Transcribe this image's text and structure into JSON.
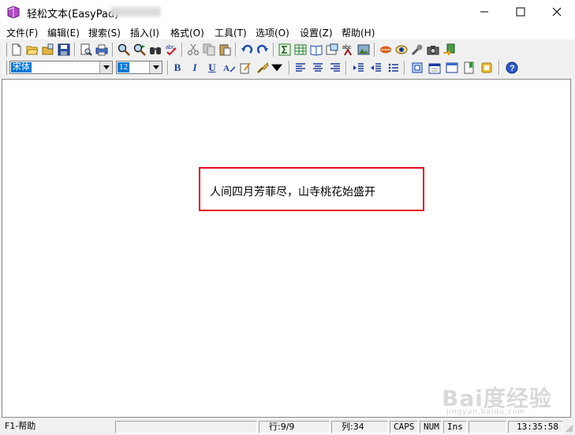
{
  "window": {
    "title": "轻松文本(EasyPad)"
  },
  "menu": [
    "文件(F)",
    "编辑(E)",
    "搜索(S)",
    "插入(I)",
    "格式(O)",
    "工具(T)",
    "选项(O)",
    "设置(Z)",
    "帮助(H)"
  ],
  "format_bar": {
    "font_name": "宋体",
    "font_size": "12",
    "bold_label": "B",
    "italic_label": "I",
    "underline_label": "U"
  },
  "document": {
    "text": "人间四月芳菲尽，山寺桃花始盛开"
  },
  "status": {
    "help": "F1-帮助",
    "row": "行:9/9",
    "col": "列:34",
    "caps": "CAPS",
    "num": "NUM",
    "ins": "Ins",
    "time": "13:35:58"
  },
  "watermark": {
    "text": "Bai度经验",
    "sub": "jingyan.baidu.com"
  },
  "icons": {
    "toolbar1": [
      "new-file-icon",
      "open-folder-icon",
      "open-recent-icon",
      "save-icon",
      "print-preview-icon",
      "print-icon",
      "find-icon",
      "find-next-icon",
      "binoculars-icon",
      "spellcheck-icon",
      "cut-icon",
      "copy-icon",
      "paste-icon",
      "undo-icon",
      "redo-icon",
      "sum-icon",
      "table-icon",
      "book-icon",
      "insert-object-icon",
      "text-art-icon",
      "image-icon",
      "lips-icon",
      "eye-icon",
      "tools-icon",
      "camera-icon",
      "export-icon"
    ],
    "toolbar2": [
      "align-left-icon",
      "align-center-icon",
      "align-right-icon",
      "indent-icon",
      "outdent-icon",
      "list-icon",
      "page-icon",
      "calendar-icon",
      "window-icon",
      "bookmark-icon",
      "note-icon",
      "help-circle-icon"
    ]
  },
  "colors": {
    "highlight": "#e0101e",
    "selection": "#0078d7",
    "format_letter": "#1c3fa8"
  }
}
